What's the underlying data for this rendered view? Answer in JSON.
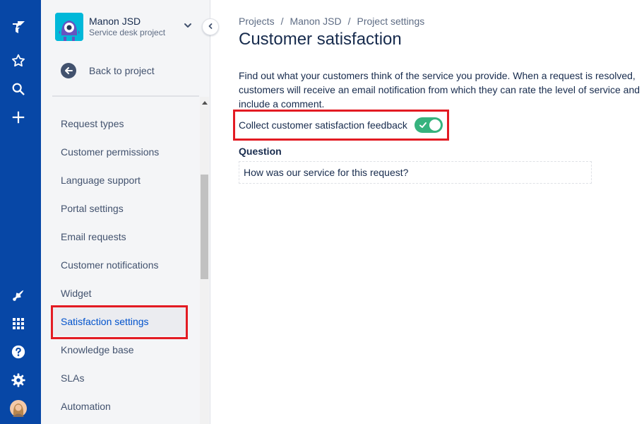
{
  "project": {
    "name": "Manon JSD",
    "type": "Service desk project"
  },
  "sidebar": {
    "back_label": "Back to project",
    "items": [
      {
        "label": "Request types",
        "active": false
      },
      {
        "label": "Customer permissions",
        "active": false
      },
      {
        "label": "Language support",
        "active": false
      },
      {
        "label": "Portal settings",
        "active": false
      },
      {
        "label": "Email requests",
        "active": false
      },
      {
        "label": "Customer notifications",
        "active": false
      },
      {
        "label": "Widget",
        "active": false
      },
      {
        "label": "Satisfaction settings",
        "active": true
      },
      {
        "label": "Knowledge base",
        "active": false
      },
      {
        "label": "SLAs",
        "active": false
      },
      {
        "label": "Automation",
        "active": false
      }
    ]
  },
  "global_nav": {
    "icons": [
      "jira-logo-icon",
      "star-icon",
      "search-icon",
      "plus-icon",
      "notification-icon",
      "app-switcher-icon",
      "help-icon",
      "settings-icon",
      "avatar"
    ]
  },
  "breadcrumb": {
    "items": [
      "Projects",
      "Manon JSD",
      "Project settings"
    ],
    "separator": "/"
  },
  "page": {
    "title": "Customer satisfaction",
    "description": "Find out what your customers think of the service you provide. When a request is resolved, customers will receive an email notification from which they can rate the level of service and include a comment.",
    "toggle_label": "Collect customer satisfaction feedback",
    "toggle_on": true,
    "question_label": "Question",
    "question_value": "How was our service for this request?"
  },
  "colors": {
    "global_nav": "#0747a6",
    "sidebar_bg": "#f4f5f7",
    "active_link": "#0052cc",
    "toggle_on": "#36b37e",
    "highlight": "#e31b23"
  }
}
